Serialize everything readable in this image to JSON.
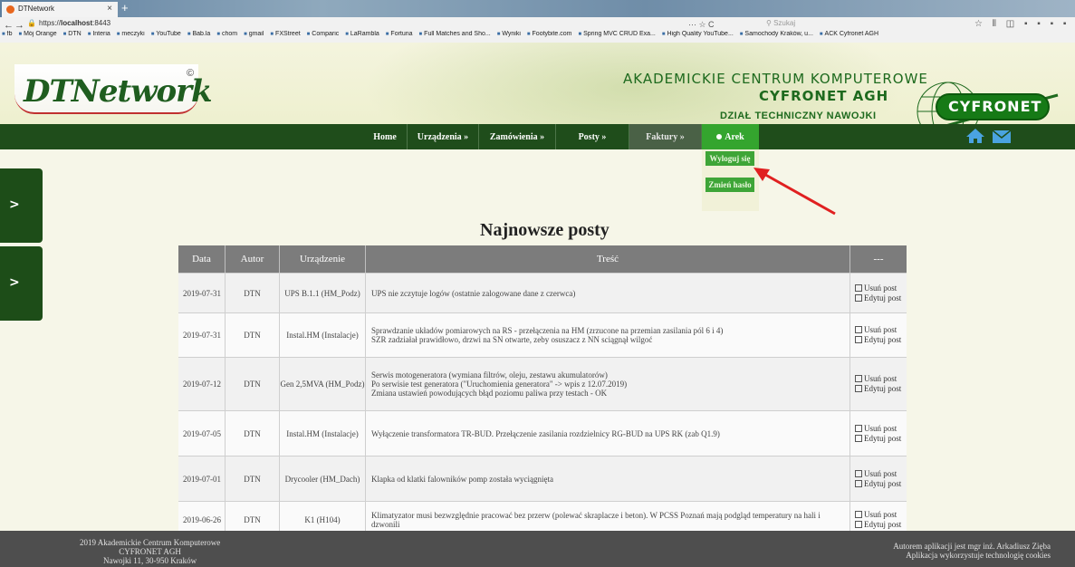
{
  "browser": {
    "tab_title": "DTNetwork",
    "tab_close": "×",
    "new_tab": "+",
    "url_host": "https://",
    "url_bold": "localhost",
    "url_port": ":8443",
    "url_right": "··· ☆ C",
    "search_placeholder": "Szukaj",
    "ext_icons": "☆ ⫴ ◫ ▪ ▪ ▪ ▪",
    "bookmarks": [
      "fb",
      "Mój Orange",
      "DTN",
      "Interia",
      "meczyki",
      "YouTube",
      "Bab.la",
      "chom",
      "gmail",
      "FXStreet",
      "Comparic",
      "LaRambla",
      "Fortuna",
      "Full Matches and Sho...",
      "Wyniki",
      "Footybite.com",
      "Spring MVC CRUD Exa...",
      "High Quality YouTube...",
      "Samochody Kraków, u...",
      "ACK Cyfronet AGH"
    ]
  },
  "header": {
    "logo_text": "DTNetwork",
    "logo_mark": "©",
    "title_line1": "AKADEMICKIE CENTRUM KOMPUTEROWE",
    "title_line2": "CYFRONET AGH",
    "title_line3": "DZIAŁ TECHNICZNY NAWOJKI",
    "cyfronet_logo": "CYFRONET"
  },
  "nav": {
    "items": [
      "Home",
      "Urządzenia »",
      "Zamówienia »",
      "Posty »",
      "Faktury »"
    ],
    "user": "Arek"
  },
  "dropdown": {
    "logout": "Wyloguj się",
    "change_password": "Zmień hasło"
  },
  "side_tabs": [
    ">",
    ">"
  ],
  "page_title": "Najnowsze posty",
  "table": {
    "headers": [
      "Data",
      "Autor",
      "Urządzenie",
      "Treść",
      "---"
    ],
    "delete_label": "Usuń post",
    "edit_label": "Edytuj post",
    "rows": [
      {
        "date": "2019-07-31",
        "author": "DTN",
        "device": "UPS B.1.1 (HM_Podz)",
        "body": "UPS nie zczytuje logów (ostatnie zalogowane dane z czerwca)"
      },
      {
        "date": "2019-07-31",
        "author": "DTN",
        "device": "Instal.HM (Instalacje)",
        "body": "Sprawdzanie układów pomiarowych na RS - przełączenia na HM (zrzucone na przemian zasilania pól 6 i 4)\nSZR zadziałał prawidłowo, drzwi na SN otwarte, zeby osuszacz z NN sciągnął wilgoć"
      },
      {
        "date": "2019-07-12",
        "author": "DTN",
        "device": "Gen 2,5MVA (HM_Podz)",
        "body": "Serwis motogeneratora (wymiana filtrów, oleju, zestawu akumulatorów)\nPo serwisie test generatora (\"Uruchomienia generatora\" -> wpis z 12.07.2019)\nZmiana ustawień powodujących błąd poziomu paliwa przy testach - OK"
      },
      {
        "date": "2019-07-05",
        "author": "DTN",
        "device": "Instal.HM (Instalacje)",
        "body": "Wyłączenie transformatora TR-BUD. Przełączenie zasilania rozdzielnicy RG-BUD na UPS RK (zab Q1.9)"
      },
      {
        "date": "2019-07-01",
        "author": "DTN",
        "device": "Drycooler (HM_Dach)",
        "body": "Klapka od klatki falowników pomp została wyciągnięta"
      },
      {
        "date": "2019-06-26",
        "author": "DTN",
        "device": "K1 (H104)",
        "body": "Klimatyzator musi bezwzględnie pracować bez przerw (polewać skraplacze i beton). W PCSS Poznań mają podgląd temperatury na hali i dzwonili"
      }
    ]
  },
  "footer": {
    "left_line1": "2019 Akademickie Centrum Komputerowe",
    "left_line2": "CYFRONET AGH",
    "left_line3": "Nawojki 11, 30-950 Kraków",
    "right_line1": "Autorem aplikacji jest mgr inż. Arkadiusz Zięba",
    "right_line2": "Aplikacja wykorzystuje technologię cookies"
  },
  "colors": {
    "nav_bg": "#1f4d1b",
    "nav_active": "#34a52e",
    "header_green": "#1e6a1e",
    "arrow": "#e02020"
  }
}
